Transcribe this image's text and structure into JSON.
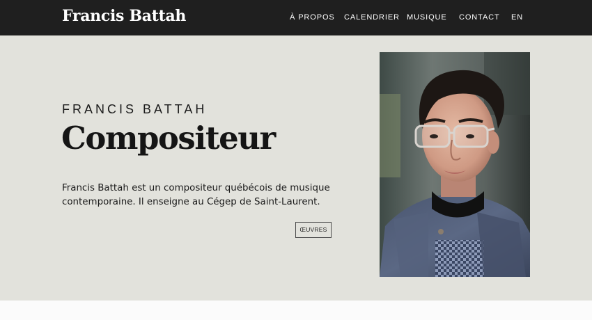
{
  "header": {
    "brand": "Francis Battah",
    "nav": [
      {
        "label": "À PROPOS"
      },
      {
        "label": "CALENDRIER"
      },
      {
        "label": "MUSIQUE"
      },
      {
        "label": "CONTACT"
      },
      {
        "label": "EN"
      }
    ]
  },
  "hero": {
    "eyebrow": "FRANCIS BATTAH",
    "title": "Compositeur",
    "bio_lines": [
      "Francis Battah est un compositeur québécois de musique",
      "contemporaine. Il enseigne au Cégep de Saint-Laurent."
    ],
    "button_label": "ŒUVRES"
  },
  "colors": {
    "navbar_bg": "#1f1f1f",
    "hero_bg": "#e2e2dc",
    "page_bg": "#fafafa",
    "text": "#151515"
  }
}
